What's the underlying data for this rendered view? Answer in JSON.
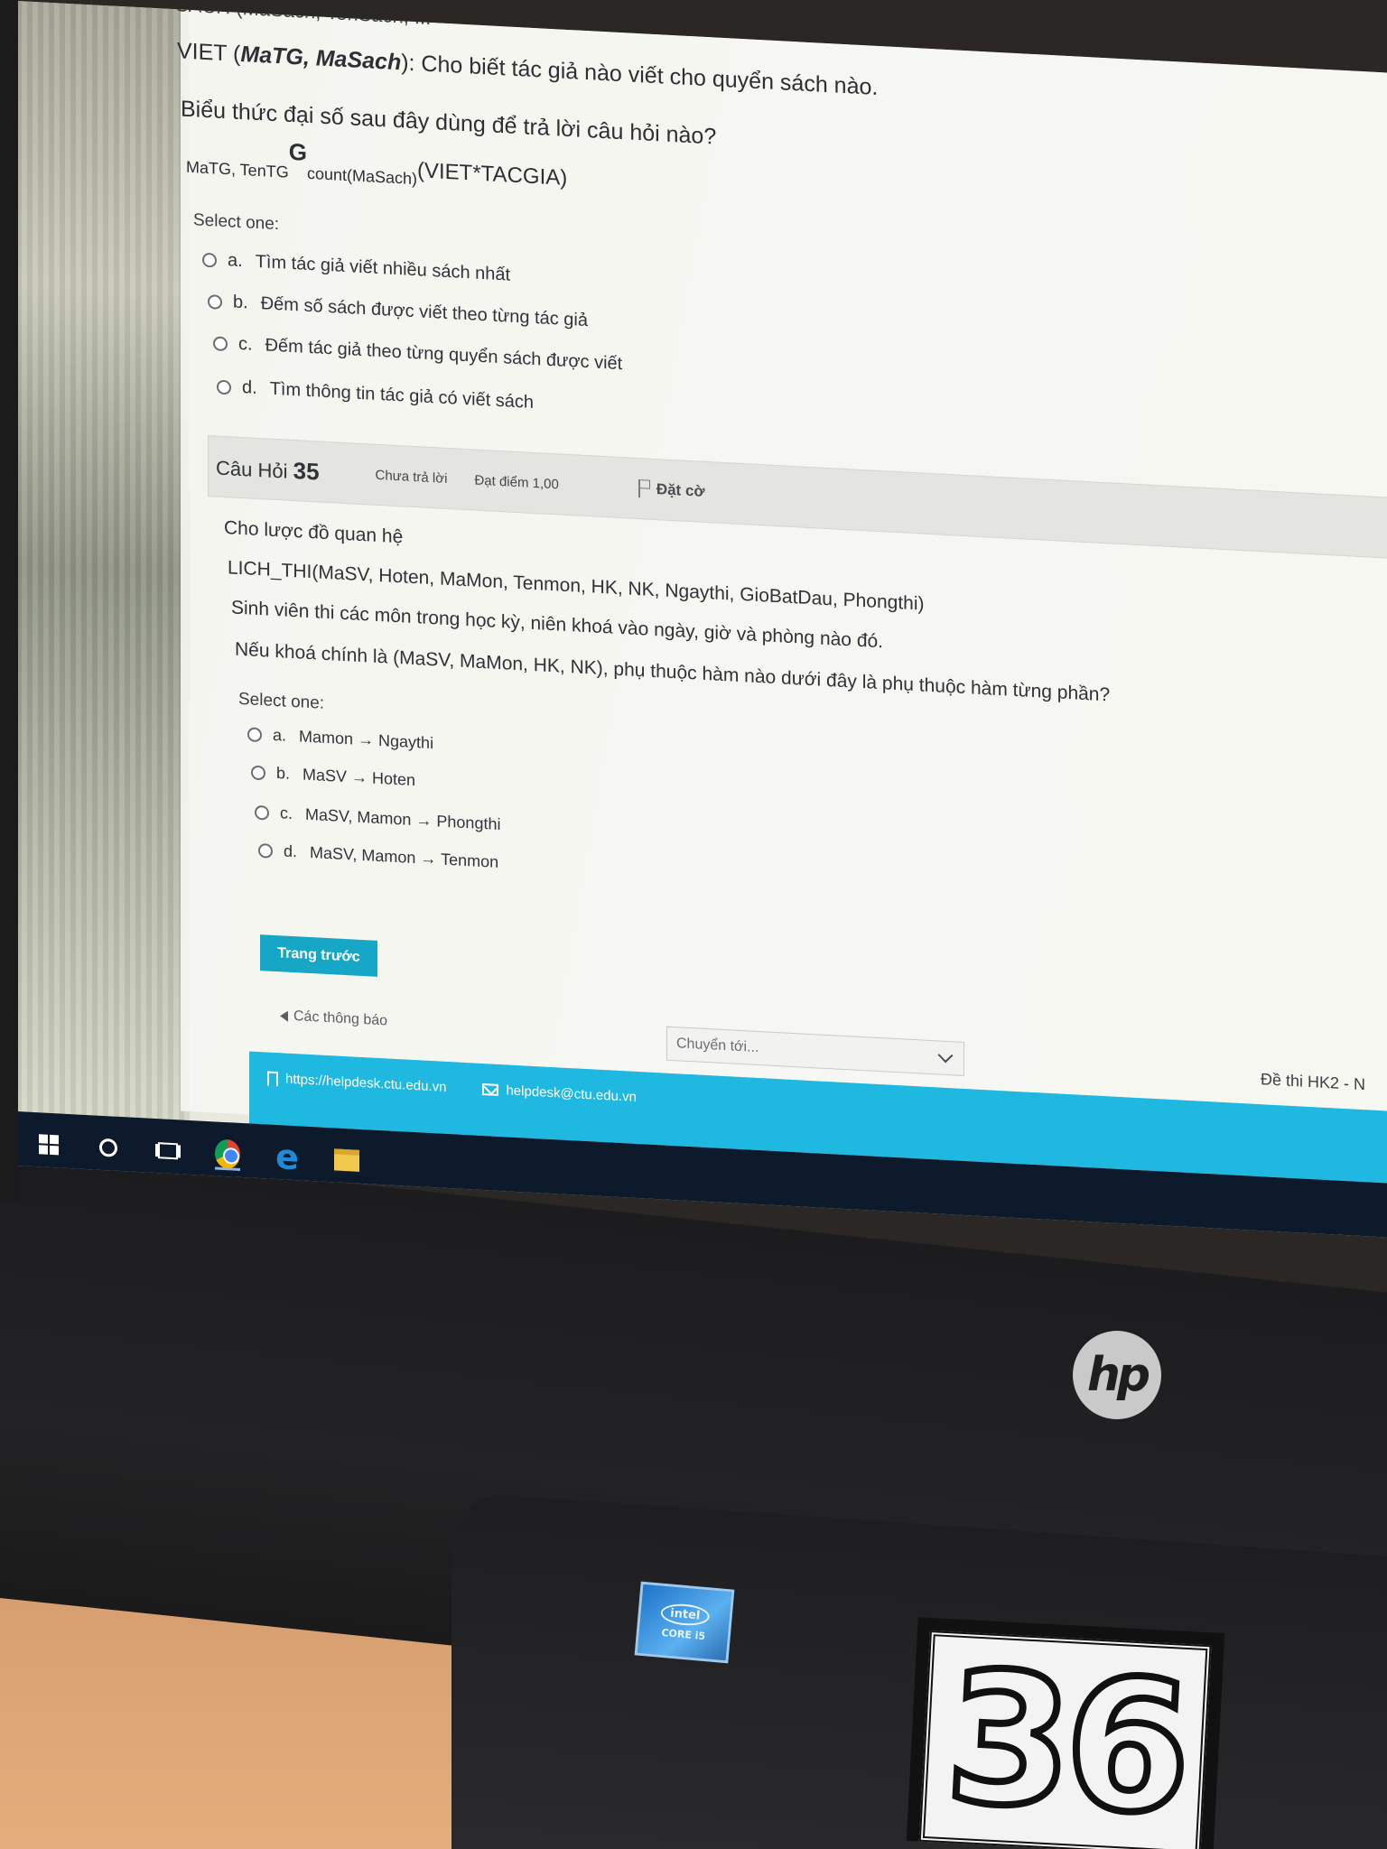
{
  "q34": {
    "prev_line": "SACH (MaSach, TenSach, ...",
    "viet_prefix": "VIET (",
    "viet_keys": "MaTG, MaSach",
    "viet_suffix": "): Cho biết tác giả nào viết cho quyển sách nào.",
    "ask": "Biểu thức đại số sau đây dùng để trả lời câu hỏi nào?",
    "expr_group": "MaTG, TenTG",
    "expr_g": "G",
    "expr_agg": "count(MaSach)",
    "expr_rel": "(VIET*TACGIA)",
    "select_label": "Select one:",
    "options": [
      {
        "letter": "a.",
        "text": "Tìm tác giả viết nhiều sách nhất"
      },
      {
        "letter": "b.",
        "text": "Đếm số sách được viết theo từng tác giả"
      },
      {
        "letter": "c.",
        "text": "Đếm tác giả theo từng quyển sách được viết"
      },
      {
        "letter": "d.",
        "text": "Tìm thông tin tác giả có viết sách"
      }
    ]
  },
  "q35": {
    "title_prefix": "Câu Hỏi",
    "number": "35",
    "status": "Chưa trả lời",
    "mark": "Đạt điểm 1,00",
    "flag": "Đặt cờ",
    "intro": "Cho lược đồ quan hệ",
    "schema": "LICH_THI(MaSV, Hoten, MaMon, Tenmon, HK, NK, Ngaythi, GioBatDau, Phongthi)",
    "desc": "Sinh viên thi các môn trong học kỳ, niên khoá vào ngày, giờ và phòng nào đó.",
    "ask": "Nếu khoá chính là (MaSV, MaMon, HK, NK), phụ thuộc hàm nào dưới đây là phụ thuộc hàm từng phần?",
    "select_label": "Select one:",
    "options": [
      {
        "letter": "a.",
        "text": "Mamon → Ngaythi"
      },
      {
        "letter": "b.",
        "text": "MaSV → Hoten"
      },
      {
        "letter": "c.",
        "text": "MaSV, Mamon → Phongthi"
      },
      {
        "letter": "d.",
        "text": "MaSV, Mamon → Tenmon"
      }
    ]
  },
  "nav": {
    "prev_button": "Trang trước",
    "back_link": "Các thông báo",
    "jump_placeholder": "Chuyển tới...",
    "exam_name": "Đề thi HK2 - N"
  },
  "footer": {
    "helpdesk_url": "https://helpdesk.ctu.edu.vn",
    "helpdesk_email": "helpdesk@ctu.edu.vn"
  },
  "hardware": {
    "brand": "hp",
    "intel_line1": "intel",
    "intel_line2": "CORE i5",
    "machine_number": "36"
  },
  "colors": {
    "accent": "#17a7c6",
    "footer": "#1fb8e0",
    "taskbar": "#0d1a2b"
  }
}
